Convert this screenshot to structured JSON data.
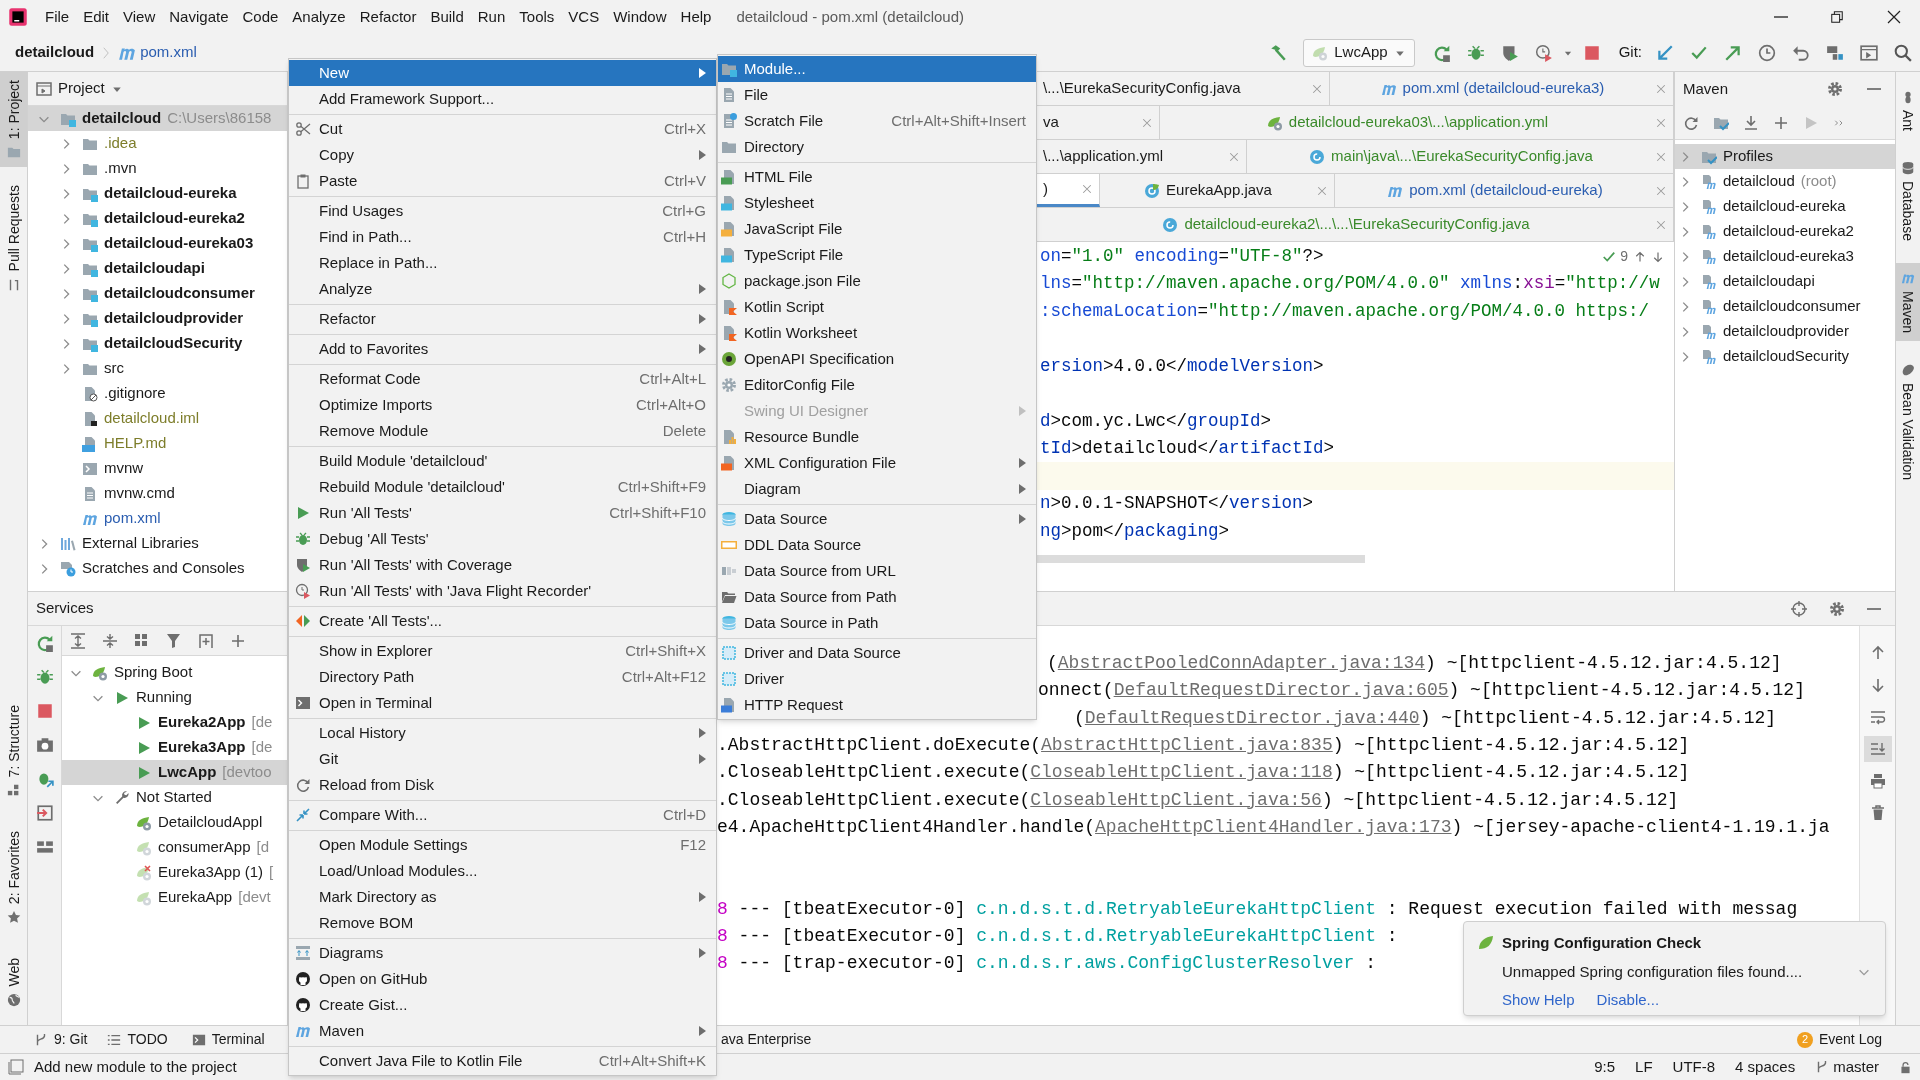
{
  "menu_bar": {
    "items": [
      "File",
      "Edit",
      "View",
      "Navigate",
      "Code",
      "Analyze",
      "Refactor",
      "Build",
      "Run",
      "Tools",
      "VCS",
      "Window",
      "Help"
    ],
    "title": "detailcloud - pom.xml (detailcloud)"
  },
  "nav_bar": {
    "project": "detailcloud",
    "file": "pom.xml",
    "run_config": "LwcApp",
    "git_label": "Git:"
  },
  "left_strip": {
    "top": [
      {
        "label": "1: Project",
        "selected": true
      },
      {
        "label": "Pull Requests",
        "selected": false
      }
    ],
    "bottom": [
      {
        "label": "7: Structure",
        "selected": false
      },
      {
        "label": "2: Favorites",
        "selected": false
      },
      {
        "label": "Web",
        "selected": false
      }
    ]
  },
  "project_panel": {
    "title": "Project",
    "tree": [
      {
        "label": "detailcloud",
        "detail": "C:\\Users\\86158",
        "kind": "module",
        "expanded": true,
        "selected": true,
        "children": [
          {
            "label": ".idea",
            "kind": "folder",
            "expanded": false,
            "selected": false,
            "color": "#7d7d2a"
          },
          {
            "label": ".mvn",
            "kind": "folder",
            "expanded": false,
            "selected": false
          },
          {
            "label": "detailcloud-eureka",
            "kind": "module",
            "expanded": false,
            "selected": false
          },
          {
            "label": "detailcloud-eureka2",
            "kind": "module",
            "expanded": false,
            "selected": false
          },
          {
            "label": "detailcloud-eureka03",
            "kind": "module",
            "expanded": false,
            "selected": false
          },
          {
            "label": "detailcloudapi",
            "kind": "module",
            "expanded": false,
            "selected": false
          },
          {
            "label": "detailcloudconsumer",
            "kind": "module",
            "expanded": false,
            "selected": false
          },
          {
            "label": "detailcloudprovider",
            "kind": "module",
            "expanded": false,
            "selected": false
          },
          {
            "label": "detailcloudSecurity",
            "kind": "module",
            "expanded": false,
            "selected": false
          },
          {
            "label": "src",
            "kind": "folder",
            "expanded": false,
            "selected": false
          },
          {
            "label": ".gitignore",
            "kind": "ignore",
            "selected": false
          },
          {
            "label": "detailcloud.iml",
            "kind": "iml",
            "selected": false,
            "color": "#7d7d2a"
          },
          {
            "label": "HELP.md",
            "kind": "md",
            "selected": false,
            "color": "#7d7d2a"
          },
          {
            "label": "mvnw",
            "kind": "mvnw",
            "selected": false
          },
          {
            "label": "mvnw.cmd",
            "kind": "file",
            "selected": false
          },
          {
            "label": "pom.xml",
            "kind": "maven",
            "selected": false,
            "color": "#2a5db0"
          }
        ]
      },
      {
        "label": "External Libraries",
        "kind": "libraries",
        "expanded": false,
        "selected": false
      },
      {
        "label": "Scratches and Consoles",
        "kind": "scratches",
        "expanded": false,
        "selected": false
      }
    ]
  },
  "services_panel": {
    "title": "Services",
    "tree": [
      {
        "label": "Spring Boot",
        "kind": "spring",
        "expanded": true,
        "selected": false,
        "children": [
          {
            "label": "Running",
            "kind": "running",
            "expanded": true,
            "selected": false,
            "children": [
              {
                "label": "Eureka2App",
                "detail": "[de",
                "kind": "app-running",
                "selected": false
              },
              {
                "label": "Eureka3App",
                "detail": "[de",
                "kind": "app-running",
                "selected": false
              },
              {
                "label": "LwcApp",
                "detail": "[devtoo",
                "kind": "app-running",
                "selected": true
              }
            ]
          },
          {
            "label": "Not Started",
            "kind": "not-started",
            "expanded": true,
            "selected": false,
            "children": [
              {
                "label": "DetailcloudAppl",
                "kind": "app",
                "selected": false
              },
              {
                "label": "consumerApp",
                "detail": "[d",
                "kind": "app-faded",
                "selected": false
              },
              {
                "label": "Eureka3App (1)",
                "detail": "[",
                "kind": "app-error",
                "selected": false
              },
              {
                "label": "EurekaApp",
                "detail": "[devt",
                "kind": "app-faded",
                "selected": false
              }
            ]
          }
        ]
      }
    ]
  },
  "editor": {
    "tab_rows": [
      [
        {
          "label": "\\...\\EurekaSecurityConfig.java",
          "kind": "plain",
          "selected": false
        },
        {
          "label": "pom.xml (detailcloud-eureka3)",
          "kind": "maven",
          "selected": false,
          "color": "#2a5db0"
        }
      ],
      [
        {
          "label": "va",
          "kind": "plain",
          "selected": false
        },
        {
          "label": "detailcloud-eureka03\\...\\application.yml",
          "kind": "spring",
          "selected": false,
          "color": "#3a8a2a"
        }
      ],
      [
        {
          "label": "\\...\\application.yml",
          "kind": "plain",
          "selected": false
        },
        {
          "label": "main\\java\\...\\EurekaSecurityConfig.java",
          "kind": "class",
          "selected": false,
          "color": "#3a8a2a"
        }
      ],
      [
        {
          "label": ")",
          "kind": "plain",
          "selected": true
        },
        {
          "label": "EurekaApp.java",
          "kind": "spring-class",
          "selected": false
        },
        {
          "label": "pom.xml (detailcloud-eureka)",
          "kind": "maven",
          "selected": false,
          "color": "#2a5db0"
        }
      ],
      [
        {
          "label": "detailcloud-eureka2\\...\\...\\EurekaSecurityConfig.java",
          "kind": "class",
          "selected": false,
          "color": "#3a8a2a"
        }
      ]
    ],
    "inspection_count": "9",
    "lines": [
      {
        "current": false,
        "tokens": [
          {
            "kind": "attr",
            "text": "on"
          },
          {
            "kind": "text",
            "text": "="
          },
          {
            "kind": "value",
            "text": "\"1.0\""
          },
          {
            "kind": "attr",
            "text": " encoding"
          },
          {
            "kind": "text",
            "text": "="
          },
          {
            "kind": "value",
            "text": "\"UTF-8\""
          },
          {
            "kind": "text",
            "text": "?>"
          }
        ]
      },
      {
        "current": false,
        "tokens": [
          {
            "kind": "attr",
            "text": "lns"
          },
          {
            "kind": "text",
            "text": "="
          },
          {
            "kind": "value",
            "text": "\"http://maven.apache.org/POM/4.0.0\""
          },
          {
            "kind": "attr",
            "text": " xmlns"
          },
          {
            "kind": "text",
            "text": ":"
          },
          {
            "kind": "ns",
            "text": "xsi"
          },
          {
            "kind": "text",
            "text": "="
          },
          {
            "kind": "value",
            "text": "\"http://w"
          }
        ]
      },
      {
        "current": false,
        "tokens": [
          {
            "kind": "attr",
            "text": ":schemaLocation"
          },
          {
            "kind": "text",
            "text": "="
          },
          {
            "kind": "value",
            "text": "\"http://maven.apache.org/POM/4.0.0 https:/"
          }
        ]
      },
      {
        "current": false
      },
      {
        "current": false,
        "tokens": [
          {
            "kind": "tag",
            "text": "ersion"
          },
          {
            "kind": "text",
            "text": ">4.0.0</"
          },
          {
            "kind": "tag",
            "text": "modelVersion"
          },
          {
            "kind": "text",
            "text": ">"
          }
        ]
      },
      {
        "current": false
      },
      {
        "current": false,
        "tokens": [
          {
            "kind": "tag",
            "text": "d"
          },
          {
            "kind": "text",
            "text": ">com.yc.Lwc</"
          },
          {
            "kind": "tag",
            "text": "groupId"
          },
          {
            "kind": "text",
            "text": ">"
          }
        ]
      },
      {
        "current": false,
        "tokens": [
          {
            "kind": "tag",
            "text": "tId"
          },
          {
            "kind": "text",
            "text": ">detailcloud</"
          },
          {
            "kind": "tag",
            "text": "artifactId"
          },
          {
            "kind": "text",
            "text": ">"
          }
        ]
      },
      {
        "current": true
      },
      {
        "current": false,
        "tokens": [
          {
            "kind": "tag",
            "text": "n"
          },
          {
            "kind": "text",
            "text": ">0.0.1-SNAPSHOT</"
          },
          {
            "kind": "tag",
            "text": "version"
          },
          {
            "kind": "text",
            "text": ">"
          }
        ]
      },
      {
        "current": false,
        "tokens": [
          {
            "kind": "tag",
            "text": "ng"
          },
          {
            "kind": "text",
            "text": ">pom</"
          },
          {
            "kind": "tag",
            "text": "packaging"
          },
          {
            "kind": "text",
            "text": ">"
          }
        ]
      }
    ]
  },
  "maven_panel": {
    "title": "Maven",
    "tree": [
      {
        "label": "Profiles",
        "kind": "profiles",
        "expanded": false,
        "selected": true
      },
      {
        "label": "detailcloud",
        "detail": "(root)",
        "kind": "maven-module",
        "expanded": false,
        "selected": false
      },
      {
        "label": "detailcloud-eureka",
        "kind": "maven-module",
        "expanded": false,
        "selected": false
      },
      {
        "label": "detailcloud-eureka2",
        "kind": "maven-module",
        "expanded": false,
        "selected": false
      },
      {
        "label": "detailcloud-eureka3",
        "kind": "maven-module",
        "expanded": false,
        "selected": false
      },
      {
        "label": "detailcloudapi",
        "kind": "maven-module",
        "expanded": false,
        "selected": false
      },
      {
        "label": "detailcloudconsumer",
        "kind": "maven-module",
        "expanded": false,
        "selected": false
      },
      {
        "label": "detailcloudprovider",
        "kind": "maven-module",
        "expanded": false,
        "selected": false
      },
      {
        "label": "detailcloudSecurity",
        "kind": "maven-module",
        "expanded": false,
        "selected": false
      }
    ]
  },
  "right_strip": [
    {
      "label": "Ant",
      "selected": false
    },
    {
      "label": "Database",
      "selected": false
    },
    {
      "label": "Maven",
      "selected": true
    },
    {
      "label": "Bean Validation",
      "selected": false
    }
  ],
  "console": {
    "lines": [
      {
        "kind": "text",
        "tokens": [
          {
            "kind": "text",
            "text": "("
          },
          {
            "kind": "link",
            "text": "AbstractPooledConnAdapter.java:134"
          },
          {
            "kind": "text",
            "text": ") ~[httpclient-4.5.12.jar:4.5.12]"
          }
        ]
      },
      {
        "kind": "text",
        "tokens": [
          {
            "kind": "text",
            "text": "onnect("
          },
          {
            "kind": "link",
            "text": "DefaultRequestDirector.java:605"
          },
          {
            "kind": "text",
            "text": ") ~[httpclient-4.5.12.jar:4.5.12]"
          }
        ]
      },
      {
        "kind": "text",
        "tokens": [
          {
            "kind": "text",
            "text": "("
          },
          {
            "kind": "link",
            "text": "DefaultRequestDirector.java:440"
          },
          {
            "kind": "text",
            "text": ") ~[httpclient-4.5.12.jar:4.5.12]"
          }
        ]
      },
      {
        "kind": "text",
        "tokens": [
          {
            "kind": "text",
            "text": ".AbstractHttpClient.doExecute("
          },
          {
            "kind": "link",
            "text": "AbstractHttpClient.java:835"
          },
          {
            "kind": "text",
            "text": ") ~[httpclient-4.5.12.jar:4.5.12]"
          }
        ]
      },
      {
        "kind": "text",
        "tokens": [
          {
            "kind": "text",
            "text": ".CloseableHttpClient.execute("
          },
          {
            "kind": "link",
            "text": "CloseableHttpClient.java:118"
          },
          {
            "kind": "text",
            "text": ") ~[httpclient-4.5.12.jar:4.5.12]"
          }
        ]
      },
      {
        "kind": "text",
        "tokens": [
          {
            "kind": "text",
            "text": ".CloseableHttpClient.execute("
          },
          {
            "kind": "link",
            "text": "CloseableHttpClient.java:56"
          },
          {
            "kind": "text",
            "text": ") ~[httpclient-4.5.12.jar:4.5.12]"
          }
        ]
      },
      {
        "kind": "text",
        "tokens": [
          {
            "kind": "text",
            "text": "e4.ApacheHttpClient4Handler.handle("
          },
          {
            "kind": "link",
            "text": "ApacheHttpClient4Handler.java:173"
          },
          {
            "kind": "text",
            "text": ") ~[jersey-apache-client4-1.19.1.ja"
          }
        ]
      },
      {
        "kind": "blank"
      },
      {
        "kind": "blank"
      },
      {
        "kind": "text",
        "tokens": [
          {
            "kind": "pid",
            "text": "8"
          },
          {
            "kind": "text",
            "text": " --- [tbeatExecutor-0] "
          },
          {
            "kind": "logger",
            "text": "c.n.d.s.t.d.RetryableEurekaHttpClient"
          },
          {
            "kind": "text",
            "text": "    : Request execution failed with messag"
          }
        ]
      },
      {
        "kind": "text",
        "tokens": [
          {
            "kind": "pid",
            "text": "8"
          },
          {
            "kind": "text",
            "text": " --- [tbeatExecutor-0] "
          },
          {
            "kind": "logger",
            "text": "c.n.d.s.t.d.RetryableEurekaHttpClient"
          },
          {
            "kind": "text",
            "text": "    :"
          }
        ]
      },
      {
        "kind": "text",
        "tokens": [
          {
            "kind": "pid",
            "text": "8"
          },
          {
            "kind": "text",
            "text": " --- [trap-executor-0] "
          },
          {
            "kind": "logger",
            "text": "c.n.d.s.r.aws.ConfigClusterResolver"
          },
          {
            "kind": "text",
            "text": "      :"
          }
        ]
      }
    ]
  },
  "notification": {
    "title": "Spring Configuration Check",
    "message": "Unmapped Spring configuration files found....",
    "actions": [
      "Show Help",
      "Disable..."
    ]
  },
  "bottom_bar": {
    "tools": [
      {
        "label": "9: Git",
        "kind": "git"
      },
      {
        "label": "TODO",
        "kind": "todo"
      },
      {
        "label": "Terminal",
        "kind": "terminal"
      },
      {
        "label": "ava Enterprise",
        "kind": "plain"
      }
    ],
    "event_log": {
      "count": "2",
      "label": "Event Log"
    }
  },
  "status_bar": {
    "message": "Add new module to the project",
    "items": [
      "9:5",
      "LF",
      "UTF-8",
      "4 spaces"
    ],
    "branch": "master"
  },
  "context_menu": {
    "items": [
      {
        "kind": "plain",
        "label": "New",
        "submenu": true,
        "selected": true
      },
      {
        "kind": "plain",
        "label": "Add Framework Support...",
        "selected": false
      },
      {
        "kind": "separator"
      },
      {
        "kind": "cut",
        "label": "Cut",
        "shortcut": "Ctrl+X",
        "selected": false
      },
      {
        "kind": "plain",
        "label": "Copy",
        "submenu": true,
        "selected": false
      },
      {
        "kind": "paste",
        "label": "Paste",
        "shortcut": "Ctrl+V",
        "selected": false
      },
      {
        "kind": "separator"
      },
      {
        "kind": "plain",
        "label": "Find Usages",
        "shortcut": "Ctrl+G",
        "selected": false
      },
      {
        "kind": "plain",
        "label": "Find in Path...",
        "shortcut": "Ctrl+H",
        "selected": false
      },
      {
        "kind": "plain",
        "label": "Replace in Path...",
        "selected": false
      },
      {
        "kind": "plain",
        "label": "Analyze",
        "submenu": true,
        "selected": false
      },
      {
        "kind": "separator"
      },
      {
        "kind": "plain",
        "label": "Refactor",
        "submenu": true,
        "selected": false
      },
      {
        "kind": "separator"
      },
      {
        "kind": "plain",
        "label": "Add to Favorites",
        "submenu": true,
        "selected": false
      },
      {
        "kind": "separator"
      },
      {
        "kind": "plain",
        "label": "Reformat Code",
        "shortcut": "Ctrl+Alt+L",
        "selected": false
      },
      {
        "kind": "plain",
        "label": "Optimize Imports",
        "shortcut": "Ctrl+Alt+O",
        "selected": false
      },
      {
        "kind": "plain",
        "label": "Remove Module",
        "shortcut": "Delete",
        "selected": false
      },
      {
        "kind": "separator"
      },
      {
        "kind": "plain",
        "label": "Build Module 'detailcloud'",
        "selected": false
      },
      {
        "kind": "plain",
        "label": "Rebuild Module 'detailcloud'",
        "shortcut": "Ctrl+Shift+F9",
        "selected": false
      },
      {
        "kind": "run",
        "label": "Run 'All Tests'",
        "shortcut": "Ctrl+Shift+F10",
        "selected": false
      },
      {
        "kind": "debug",
        "label": "Debug 'All Tests'",
        "selected": false
      },
      {
        "kind": "coverage",
        "label": "Run 'All Tests' with Coverage",
        "selected": false
      },
      {
        "kind": "jfr",
        "label": "Run 'All Tests' with 'Java Flight Recorder'",
        "selected": false
      },
      {
        "kind": "separator"
      },
      {
        "kind": "create",
        "label": "Create 'All Tests'...",
        "selected": false
      },
      {
        "kind": "separator"
      },
      {
        "kind": "plain",
        "label": "Show in Explorer",
        "shortcut": "Ctrl+Shift+X",
        "selected": false
      },
      {
        "kind": "plain",
        "label": "Directory Path",
        "shortcut": "Ctrl+Alt+F12",
        "selected": false
      },
      {
        "kind": "terminal",
        "label": "Open in Terminal",
        "selected": false
      },
      {
        "kind": "separator"
      },
      {
        "kind": "plain",
        "label": "Local History",
        "submenu": true,
        "selected": false
      },
      {
        "kind": "plain",
        "label": "Git",
        "submenu": true,
        "selected": false
      },
      {
        "kind": "reload",
        "label": "Reload from Disk",
        "selected": false
      },
      {
        "kind": "separator"
      },
      {
        "kind": "compare",
        "label": "Compare With...",
        "shortcut": "Ctrl+D",
        "selected": false
      },
      {
        "kind": "separator"
      },
      {
        "kind": "plain",
        "label": "Open Module Settings",
        "shortcut": "F12",
        "selected": false
      },
      {
        "kind": "plain",
        "label": "Load/Unload Modules...",
        "selected": false
      },
      {
        "kind": "plain",
        "label": "Mark Directory as",
        "submenu": true,
        "selected": false
      },
      {
        "kind": "plain",
        "label": "Remove BOM",
        "selected": false
      },
      {
        "kind": "separator"
      },
      {
        "kind": "diagrams",
        "label": "Diagrams",
        "submenu": true,
        "selected": false
      },
      {
        "kind": "github",
        "label": "Open on GitHub",
        "selected": false
      },
      {
        "kind": "github",
        "label": "Create Gist...",
        "selected": false
      },
      {
        "kind": "maven",
        "label": "Maven",
        "submenu": true,
        "selected": false
      },
      {
        "kind": "separator"
      },
      {
        "kind": "plain",
        "label": "Convert Java File to Kotlin File",
        "shortcut": "Ctrl+Alt+Shift+K",
        "selected": false
      }
    ]
  },
  "new_submenu": {
    "items": [
      {
        "kind": "module",
        "label": "Module...",
        "selected": true,
        "disabled": false
      },
      {
        "kind": "file",
        "label": "File",
        "selected": false,
        "disabled": false
      },
      {
        "kind": "scratch",
        "label": "Scratch File",
        "shortcut": "Ctrl+Alt+Shift+Insert",
        "selected": false,
        "disabled": false
      },
      {
        "kind": "folder",
        "label": "Directory",
        "selected": false,
        "disabled": false
      },
      {
        "kind": "separator"
      },
      {
        "kind": "html",
        "label": "HTML File",
        "selected": false,
        "disabled": false
      },
      {
        "kind": "css",
        "label": "Stylesheet",
        "selected": false,
        "disabled": false
      },
      {
        "kind": "js",
        "label": "JavaScript File",
        "selected": false,
        "disabled": false
      },
      {
        "kind": "ts",
        "label": "TypeScript File",
        "selected": false,
        "disabled": false
      },
      {
        "kind": "pkg",
        "label": "package.json File",
        "selected": false,
        "disabled": false
      },
      {
        "kind": "kotlin",
        "label": "Kotlin Script",
        "selected": false,
        "disabled": false
      },
      {
        "kind": "kotlin",
        "label": "Kotlin Worksheet",
        "selected": false,
        "disabled": false
      },
      {
        "kind": "openapi",
        "label": "OpenAPI Specification",
        "selected": false,
        "disabled": false
      },
      {
        "kind": "gear",
        "label": "EditorConfig File",
        "selected": false,
        "disabled": false
      },
      {
        "kind": "plain",
        "label": "Swing UI Designer",
        "submenu": true,
        "selected": false,
        "disabled": true
      },
      {
        "kind": "resource",
        "label": "Resource Bundle",
        "selected": false,
        "disabled": false
      },
      {
        "kind": "xml",
        "label": "XML Configuration File",
        "submenu": true,
        "selected": false,
        "disabled": false
      },
      {
        "kind": "plain",
        "label": "Diagram",
        "submenu": true,
        "selected": false,
        "disabled": false
      },
      {
        "kind": "separator"
      },
      {
        "kind": "db",
        "label": "Data Source",
        "submenu": true,
        "selected": false,
        "disabled": false
      },
      {
        "kind": "ddl",
        "label": "DDL Data Source",
        "selected": false,
        "disabled": false
      },
      {
        "kind": "url",
        "label": "Data Source from URL",
        "selected": false,
        "disabled": false
      },
      {
        "kind": "path",
        "label": "Data Source from Path",
        "selected": false,
        "disabled": false
      },
      {
        "kind": "db",
        "label": "Data Source in Path",
        "selected": false,
        "disabled": false
      },
      {
        "kind": "separator"
      },
      {
        "kind": "driver",
        "label": "Driver and Data Source",
        "selected": false,
        "disabled": false
      },
      {
        "kind": "driver",
        "label": "Driver",
        "selected": false,
        "disabled": false
      },
      {
        "kind": "http",
        "label": "HTTP Request",
        "selected": false,
        "disabled": false
      }
    ]
  }
}
